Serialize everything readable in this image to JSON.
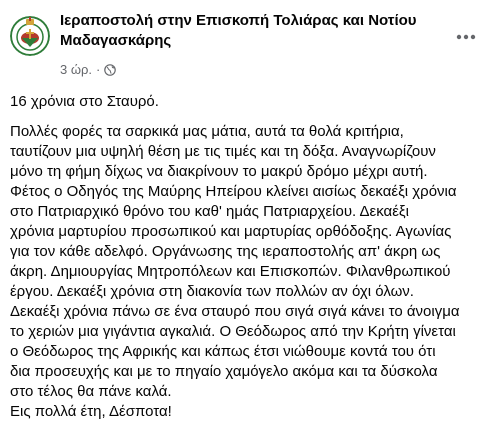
{
  "page": {
    "name": "Ιεραποστολή στην Επισκοπή Τολιάρας και Νοτίου Μαδαγασκάρης",
    "time": "3 ώρ.",
    "separator": "·",
    "avatar_icon": "mission-crest-icon",
    "privacy_icon": "globe-icon",
    "more_icon": "more-options-icon"
  },
  "post": {
    "title_line": "16 χρόνια στο Σταυρό.",
    "body": "Πολλές φορές τα σαρκικά μας μάτια, αυτά τα θολά κριτήρια,\nταυτίζουν μια υψηλή θέση με τις τιμές και τη δόξα. Αναγνωρίζουν\nμόνο τη φήμη δίχως να διακρίνουν το μακρύ δρόμο μέχρι αυτή.\nΦέτος ο Οδηγός της Μαύρης Ηπείρου κλείνει αισίως δεκαέξι χρόνια\nστο Πατριαρχικό θρόνο του καθ' ημάς Πατριαρχείου. Δεκαέξι\nχρόνια μαρτυρίου προσωπικού και μαρτυρίας ορθόδοξης. Αγωνίας\nγια τον κάθε αδελφό. Οργάνωσης της ιεραποστολής απ' άκρη ως\nάκρη. Δημιουργίας Μητροπόλεων και Επισκοπών. Φιλανθρωπικού\nέργου. Δεκαέξι χρόνια στη διακονία των πολλών αν όχι όλων.\nΔεκαέξι χρόνια πάνω σε ένα σταυρό που σιγά σιγά κάνει το άνοιγμα\nτο χεριών μια γιγάντια αγκαλιά. Ο Θεόδωρος από την Κρήτη γίνεται\nο Θεόδωρος της Αφρικής και κάπως έτσι νιώθουμε κοντά του ότι\nδια προσευχής και με το πηγαίο χαμόγελο ακόμα και τα δύσκολα\nστο τέλος θα πάνε καλά.\nΕις πολλά έτη, Δέσποτα!"
  },
  "colors": {
    "text": "#050505",
    "secondary": "#65676b",
    "crest_green": "#2f7d3a",
    "crest_red": "#b33a2c",
    "crest_gold": "#d4a43a"
  }
}
